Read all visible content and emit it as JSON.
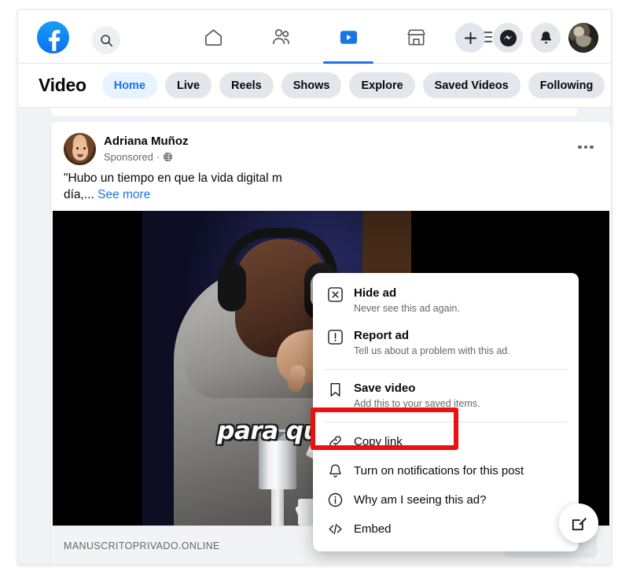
{
  "topnav": {
    "logo_icon": "facebook-logo-icon",
    "search_icon": "search-icon",
    "tabs": [
      {
        "name": "home",
        "icon": "home-icon",
        "active": false
      },
      {
        "name": "friends",
        "icon": "friends-icon",
        "active": false
      },
      {
        "name": "video",
        "icon": "video-icon",
        "active": true
      },
      {
        "name": "marketplace",
        "icon": "marketplace-icon",
        "active": false
      },
      {
        "name": "menu",
        "icon": "hamburger-menu-icon",
        "active": false
      }
    ],
    "actions": [
      {
        "name": "create",
        "icon": "plus-icon"
      },
      {
        "name": "messenger",
        "icon": "messenger-icon"
      },
      {
        "name": "notifications",
        "icon": "bell-icon"
      },
      {
        "name": "profile",
        "icon": "avatar-icon"
      }
    ]
  },
  "videobar": {
    "title": "Video",
    "tabs": [
      {
        "label": "Home",
        "active": true
      },
      {
        "label": "Live",
        "active": false
      },
      {
        "label": "Reels",
        "active": false
      },
      {
        "label": "Shows",
        "active": false
      },
      {
        "label": "Explore",
        "active": false
      },
      {
        "label": "Saved Videos",
        "active": false
      },
      {
        "label": "Following",
        "active": false
      }
    ],
    "search_icon": "search-icon"
  },
  "post": {
    "author": "Adriana Muñoz",
    "sponsored_label": "Sponsored",
    "separator": "·",
    "audience_icon": "globe-icon",
    "text": "\"Hubo un tiempo en que la vida digital m",
    "text_line2": "día,...",
    "see_more": "See more",
    "more_options_icon": "ellipsis-icon",
    "video_caption": "para que",
    "link_domain": "MANUSCRITOPRIVADO.ONLINE"
  },
  "menu": {
    "items": [
      {
        "title": "Hide ad",
        "subtitle": "Never see this ad again.",
        "icon": "x-square-icon",
        "highlighted": false
      },
      {
        "title": "Report ad",
        "subtitle": "Tell us about a problem with this ad.",
        "icon": "exclamation-square-icon",
        "highlighted": false
      },
      {
        "title": "Save video",
        "subtitle": "Add this to your saved items.",
        "icon": "bookmark-icon",
        "highlighted": false
      },
      {
        "title": "Copy link",
        "subtitle": "",
        "icon": "link-icon",
        "highlighted": true
      },
      {
        "title": "Turn on notifications for this post",
        "subtitle": "",
        "icon": "bell-outline-icon",
        "highlighted": false
      },
      {
        "title": "Why am I seeing this ad?",
        "subtitle": "",
        "icon": "info-circle-icon",
        "highlighted": false
      },
      {
        "title": "Embed",
        "subtitle": "",
        "icon": "code-icon",
        "highlighted": false
      }
    ]
  },
  "fab": {
    "icon": "compose-icon"
  },
  "colors": {
    "brand_blue": "#1b74e4",
    "active_pill_bg": "#e7f3ff",
    "pill_bg": "#e4e6eb",
    "page_bg": "#f0f2f5",
    "highlight_red": "#ee1010"
  }
}
